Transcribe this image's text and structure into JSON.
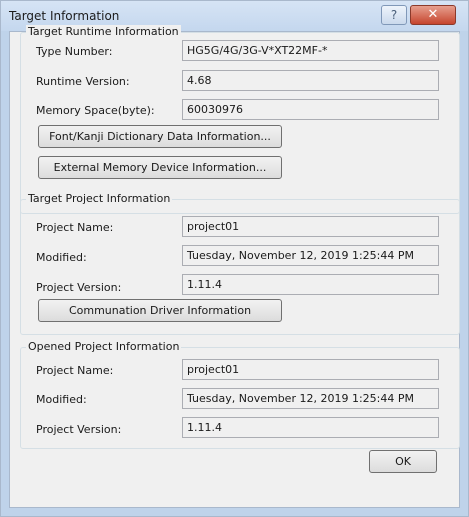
{
  "window": {
    "title": "Target Information",
    "help_glyph": "?",
    "close_glyph": "✕"
  },
  "runtime": {
    "legend": "Target Runtime Information",
    "type_label": "Type Number:",
    "type_value": "HG5G/4G/3G-V*XT22MF-*",
    "version_label": "Runtime Version:",
    "version_value": "4.68",
    "memory_label": "Memory Space(byte):",
    "memory_value": "60030976",
    "font_button": "Font/Kanji Dictionary Data Information...",
    "memory_button": "External Memory Device Information..."
  },
  "target_project": {
    "legend": "Target Project Information",
    "name_label": "Project Name:",
    "name_value": "project01",
    "modified_label": "Modified:",
    "modified_value": "Tuesday, November 12, 2019 1:25:44 PM",
    "version_label": "Project Version:",
    "version_value": "1.11.4",
    "driver_button": "Communation Driver Information"
  },
  "opened_project": {
    "legend": "Opened Project Information",
    "name_label": "Project Name:",
    "name_value": "project01",
    "modified_label": "Modified:",
    "modified_value": "Tuesday, November 12, 2019 1:25:44 PM",
    "version_label": "Project Version:",
    "version_value": "1.11.4"
  },
  "footer": {
    "ok_label": "OK"
  }
}
